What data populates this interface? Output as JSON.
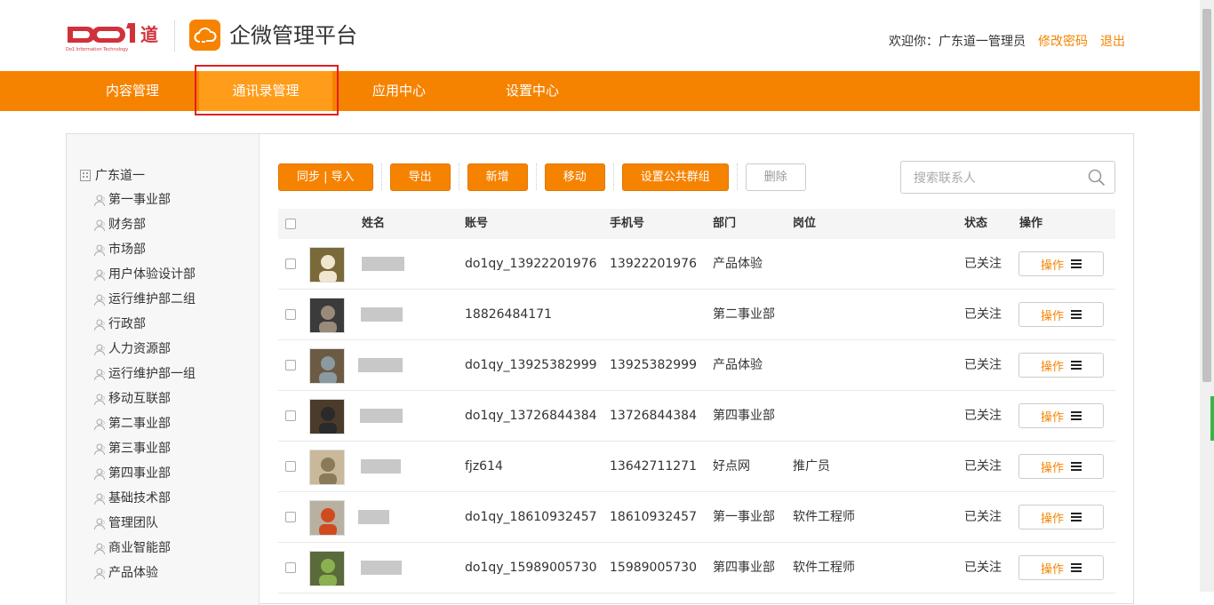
{
  "brand": {
    "logo_text": "DO1道",
    "logo_sub": "Do1 Information Technology",
    "app_title": "企微管理平台"
  },
  "user": {
    "welcome": "欢迎你：广东道一管理员",
    "change_password": "修改密码",
    "logout": "退出"
  },
  "nav": {
    "items": [
      {
        "label": "内容管理"
      },
      {
        "label": "通讯录管理"
      },
      {
        "label": "应用中心"
      },
      {
        "label": "设置中心"
      }
    ],
    "active_index": 1
  },
  "sidebar": {
    "root": "广东道一",
    "items": [
      "第一事业部",
      "财务部",
      "市场部",
      "用户体验设计部",
      "运行维护部二组",
      "行政部",
      "人力资源部",
      "运行维护部一组",
      "移动互联部",
      "第二事业部",
      "第三事业部",
      "第四事业部",
      "基础技术部",
      "管理团队",
      "商业智能部",
      "产品体验"
    ]
  },
  "toolbar": {
    "sync_import": "同步 | 导入",
    "export": "导出",
    "add": "新增",
    "move": "移动",
    "set_group": "设置公共群组",
    "delete": "删除"
  },
  "search": {
    "placeholder": "搜索联系人"
  },
  "table": {
    "headers": {
      "name": "姓名",
      "account": "账号",
      "phone": "手机号",
      "department": "部门",
      "position": "岗位",
      "status": "状态",
      "action": "操作"
    },
    "rows": [
      {
        "account": "do1qy_13922201976",
        "phone": "13922201976",
        "department": "产品体验",
        "position": "",
        "status": "已关注",
        "action": "操作"
      },
      {
        "account": "18826484171",
        "phone": "",
        "department": "第二事业部",
        "position": "",
        "status": "已关注",
        "action": "操作"
      },
      {
        "account": "do1qy_13925382999",
        "phone": "13925382999",
        "department": "产品体验",
        "position": "",
        "status": "已关注",
        "action": "操作"
      },
      {
        "account": "do1qy_13726844384",
        "phone": "13726844384",
        "department": "第四事业部",
        "position": "",
        "status": "已关注",
        "action": "操作"
      },
      {
        "account": "fjz614",
        "phone": "13642711271",
        "department": "好点网",
        "position": "推广员",
        "status": "已关注",
        "action": "操作"
      },
      {
        "account": "do1qy_18610932457",
        "phone": "18610932457",
        "department": "第一事业部",
        "position": "软件工程师",
        "status": "已关注",
        "action": "操作"
      },
      {
        "account": "do1qy_15989005730",
        "phone": "15989005730",
        "department": "第四事业部",
        "position": "软件工程师",
        "status": "已关注",
        "action": "操作"
      }
    ]
  },
  "colors": {
    "accent": "#f68300",
    "nav_active": "#ff9c1a",
    "highlight_border": "#e02020",
    "brand_red": "#d0323b"
  }
}
